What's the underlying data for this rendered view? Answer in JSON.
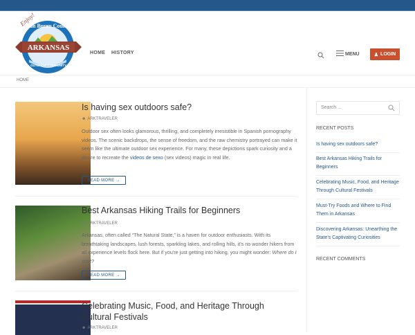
{
  "logo": {
    "script": "Enjoy!",
    "top": "Van Buren County",
    "banner": "ARKANSAS",
    "bottom": "OUTDOOR COMMUNITY"
  },
  "nav": {
    "home": "HOME",
    "history": "HISTORY",
    "menu": "MENU",
    "login": "LOGIN"
  },
  "breadcrumb": "HOME",
  "posts": [
    {
      "title": "Is having sex outdoors safe?",
      "author": "ARKTRAVELER",
      "excerpt_before": "Outdoor sex often looks glamorous, thrilling, and completely irresistible in Spanish pornography videos. The scenic backdrops, the sense of freedom, and the raw chemistry portrayed can make it seem like the ultimate outdoor sex experience. For many, these depictions spark curiosity and a desire to recreate the ",
      "link": "videos de sexo",
      "excerpt_after": " (sex videos) magic in real life.",
      "read_more": "READ MORE →"
    },
    {
      "title": "Best Arkansas Hiking Trails for Beginners",
      "author": "ARKTRAVELER",
      "excerpt_before": "Arkansas, often called “The Natural State,” is a haven for outdoor enthusiasts. With its breathtaking landscapes, lush forests, sparkling lakes, and rolling hills, it's no wonder hikers from all experience levels flock here. But if you're just getting into hiking, you might wonder: ",
      "italic": "Where do I start?",
      "read_more": "READ MORE →"
    },
    {
      "title": "Celebrating Music, Food, and Heritage Through Cultural Festivals",
      "author": "ARKTRAVELER"
    }
  ],
  "sidebar": {
    "search_placeholder": "Search ...",
    "recent_posts_heading": "RECENT POSTS",
    "recent_posts": [
      "Is having sex outdoors safe?",
      "Best Arkansas Hiking Trails for Beginners",
      "Celebrating Music, Food, and Heritage Through Cultural Festivals",
      "Must-Try Foods and Where to Find Them in Arkansas",
      "Discovering Arkansas: Unearthing the State's Captivating Curiosities"
    ],
    "recent_comments_heading": "RECENT COMMENTS"
  }
}
